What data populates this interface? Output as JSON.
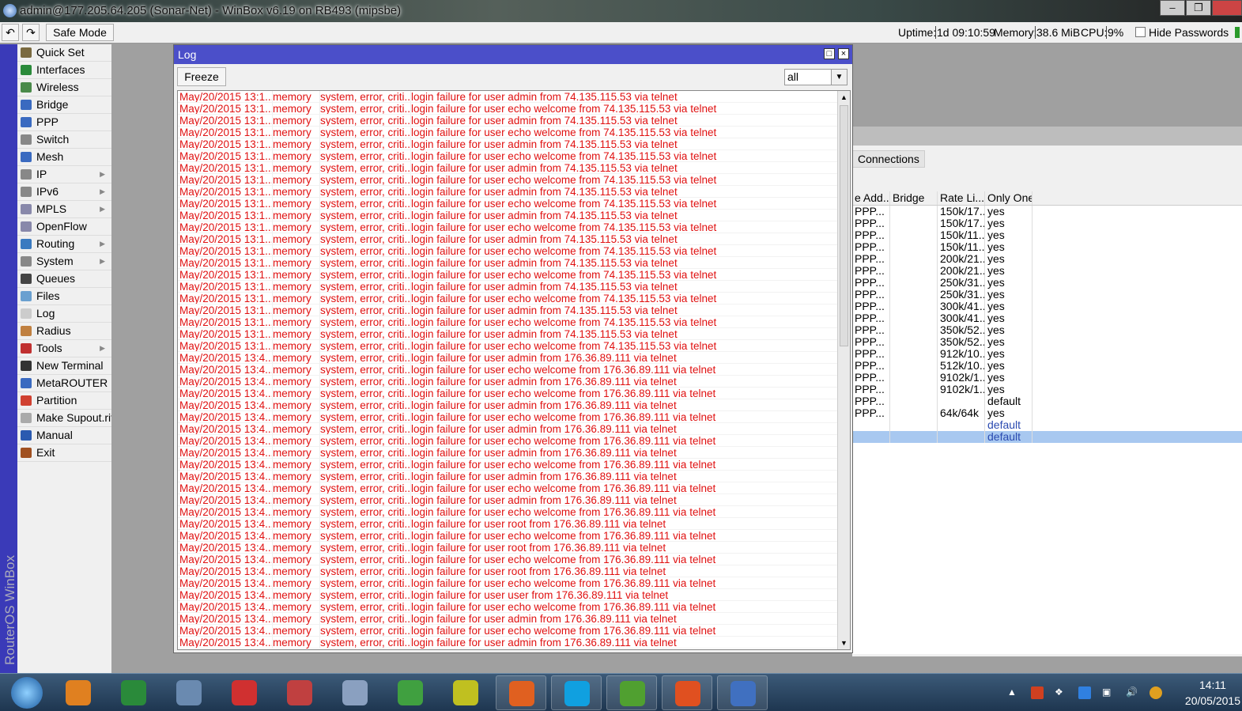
{
  "window": {
    "title": "admin@177.205.64.205 (Sonar-Net) - WinBox v6.19 on RB493 (mipsbe)"
  },
  "toolbar": {
    "undo": "↶",
    "redo": "↷",
    "safe_mode": "Safe Mode",
    "uptime_label": "Uptime:",
    "uptime": "1d 09:10:59",
    "memory_label": "Memory:",
    "memory": "38.6 MiB",
    "cpu_label": "CPU:",
    "cpu": "9%",
    "hide_passwords": "Hide Passwords",
    "hide_passwords_checked": false
  },
  "sidebar": {
    "brand": "RouterOS WinBox",
    "items": [
      {
        "label": "Quick Set",
        "color": "#7a6a40"
      },
      {
        "label": "Interfaces",
        "color": "#2a8a3a"
      },
      {
        "label": "Wireless",
        "color": "#4a8a4a"
      },
      {
        "label": "Bridge",
        "color": "#3a6ac0"
      },
      {
        "label": "PPP",
        "color": "#3a6ac0"
      },
      {
        "label": "Switch",
        "color": "#888"
      },
      {
        "label": "Mesh",
        "color": "#3a6ac0"
      },
      {
        "label": "IP",
        "color": "#888",
        "submenu": true
      },
      {
        "label": "IPv6",
        "color": "#888",
        "submenu": true
      },
      {
        "label": "MPLS",
        "color": "#88a",
        "submenu": true
      },
      {
        "label": "OpenFlow",
        "color": "#88a"
      },
      {
        "label": "Routing",
        "color": "#3a7ac0",
        "submenu": true
      },
      {
        "label": "System",
        "color": "#888",
        "submenu": true
      },
      {
        "label": "Queues",
        "color": "#444"
      },
      {
        "label": "Files",
        "color": "#6aa0d0"
      },
      {
        "label": "Log",
        "color": "#ccc"
      },
      {
        "label": "Radius",
        "color": "#c08040"
      },
      {
        "label": "Tools",
        "color": "#c03030",
        "submenu": true
      },
      {
        "label": "New Terminal",
        "color": "#333"
      },
      {
        "label": "MetaROUTER",
        "color": "#3a6ac0"
      },
      {
        "label": "Partition",
        "color": "#d04030"
      },
      {
        "label": "Make Supout.rif",
        "color": "#aaa"
      },
      {
        "label": "Manual",
        "color": "#2a5ab0"
      },
      {
        "label": "Exit",
        "color": "#a05020"
      }
    ]
  },
  "log": {
    "title": "Log",
    "freeze": "Freeze",
    "filter": "all",
    "rows": []
  },
  "log_groups": [
    {
      "time": "May/20/2015 13:1...",
      "ip": "74.135.115.53",
      "users": [
        "admin",
        "echo welcome",
        "admin",
        "echo welcome",
        "admin",
        "echo welcome",
        "admin",
        "echo welcome",
        "admin",
        "echo welcome",
        "admin",
        "echo welcome",
        "admin",
        "echo welcome",
        "admin",
        "echo welcome",
        "admin",
        "echo welcome",
        "admin",
        "echo welcome",
        "admin",
        "echo welcome"
      ]
    },
    {
      "time": "May/20/2015 13:4...",
      "ip": "176.36.89.111",
      "users": [
        "admin",
        "echo welcome",
        "admin",
        "echo welcome",
        "admin",
        "echo welcome",
        "admin",
        "echo welcome",
        "admin",
        "echo welcome",
        "admin",
        "echo welcome",
        "admin",
        "echo welcome",
        "root",
        "echo welcome",
        "root",
        "echo welcome",
        "root",
        "echo welcome",
        "user",
        "echo welcome",
        "admin",
        "echo welcome",
        "admin"
      ]
    }
  ],
  "log_topic": "memory",
  "log_tags": "system, error, criti...",
  "background_window": {
    "tab": "Connections",
    "columns": [
      "e Add...",
      "Bridge",
      "Rate Li...",
      "Only One"
    ],
    "rows": [
      [
        "PPP...",
        "",
        "150k/17...",
        "yes"
      ],
      [
        "PPP...",
        "",
        "150k/17...",
        "yes"
      ],
      [
        "PPP...",
        "",
        "150k/11...",
        "yes"
      ],
      [
        "PPP...",
        "",
        "150k/11...",
        "yes"
      ],
      [
        "PPP...",
        "",
        "200k/21...",
        "yes"
      ],
      [
        "PPP...",
        "",
        "200k/21...",
        "yes"
      ],
      [
        "PPP...",
        "",
        "250k/31...",
        "yes"
      ],
      [
        "PPP...",
        "",
        "250k/31...",
        "yes"
      ],
      [
        "PPP...",
        "",
        "300k/41...",
        "yes"
      ],
      [
        "PPP...",
        "",
        "300k/41...",
        "yes"
      ],
      [
        "PPP...",
        "",
        "350k/52...",
        "yes"
      ],
      [
        "PPP...",
        "",
        "350k/52...",
        "yes"
      ],
      [
        "PPP...",
        "",
        "912k/10...",
        "yes"
      ],
      [
        "PPP...",
        "",
        "512k/10...",
        "yes"
      ],
      [
        "PPP...",
        "",
        "9102k/1...",
        "yes"
      ],
      [
        "PPP...",
        "",
        "9102k/1...",
        "yes"
      ],
      [
        "PPP...",
        "",
        "",
        "default"
      ],
      [
        "PPP...",
        "",
        "64k/64k",
        "yes"
      ],
      [
        "",
        "",
        "",
        "default"
      ],
      [
        "",
        "",
        "",
        "default"
      ]
    ]
  },
  "taskbar": {
    "clock_time": "14:11",
    "clock_date": "20/05/2015",
    "apps": [
      {
        "name": "media-player",
        "color": "#e08020"
      },
      {
        "name": "spreadsheet",
        "color": "#2a8a3a"
      },
      {
        "name": "virtualbox",
        "color": "#6a8ab0"
      },
      {
        "name": "chrome",
        "color": "#d03030"
      },
      {
        "name": "snipping-tool",
        "color": "#c04040"
      },
      {
        "name": "calculator",
        "color": "#8aa0c0"
      },
      {
        "name": "network-tool",
        "color": "#40a040"
      },
      {
        "name": "grid-app",
        "color": "#c0c020"
      },
      {
        "name": "firefox",
        "color": "#e06020"
      },
      {
        "name": "skype",
        "color": "#10a0e0"
      },
      {
        "name": "utorrent",
        "color": "#50a030"
      },
      {
        "name": "mail",
        "color": "#e05020"
      },
      {
        "name": "winbox",
        "color": "#4070c0"
      }
    ]
  }
}
